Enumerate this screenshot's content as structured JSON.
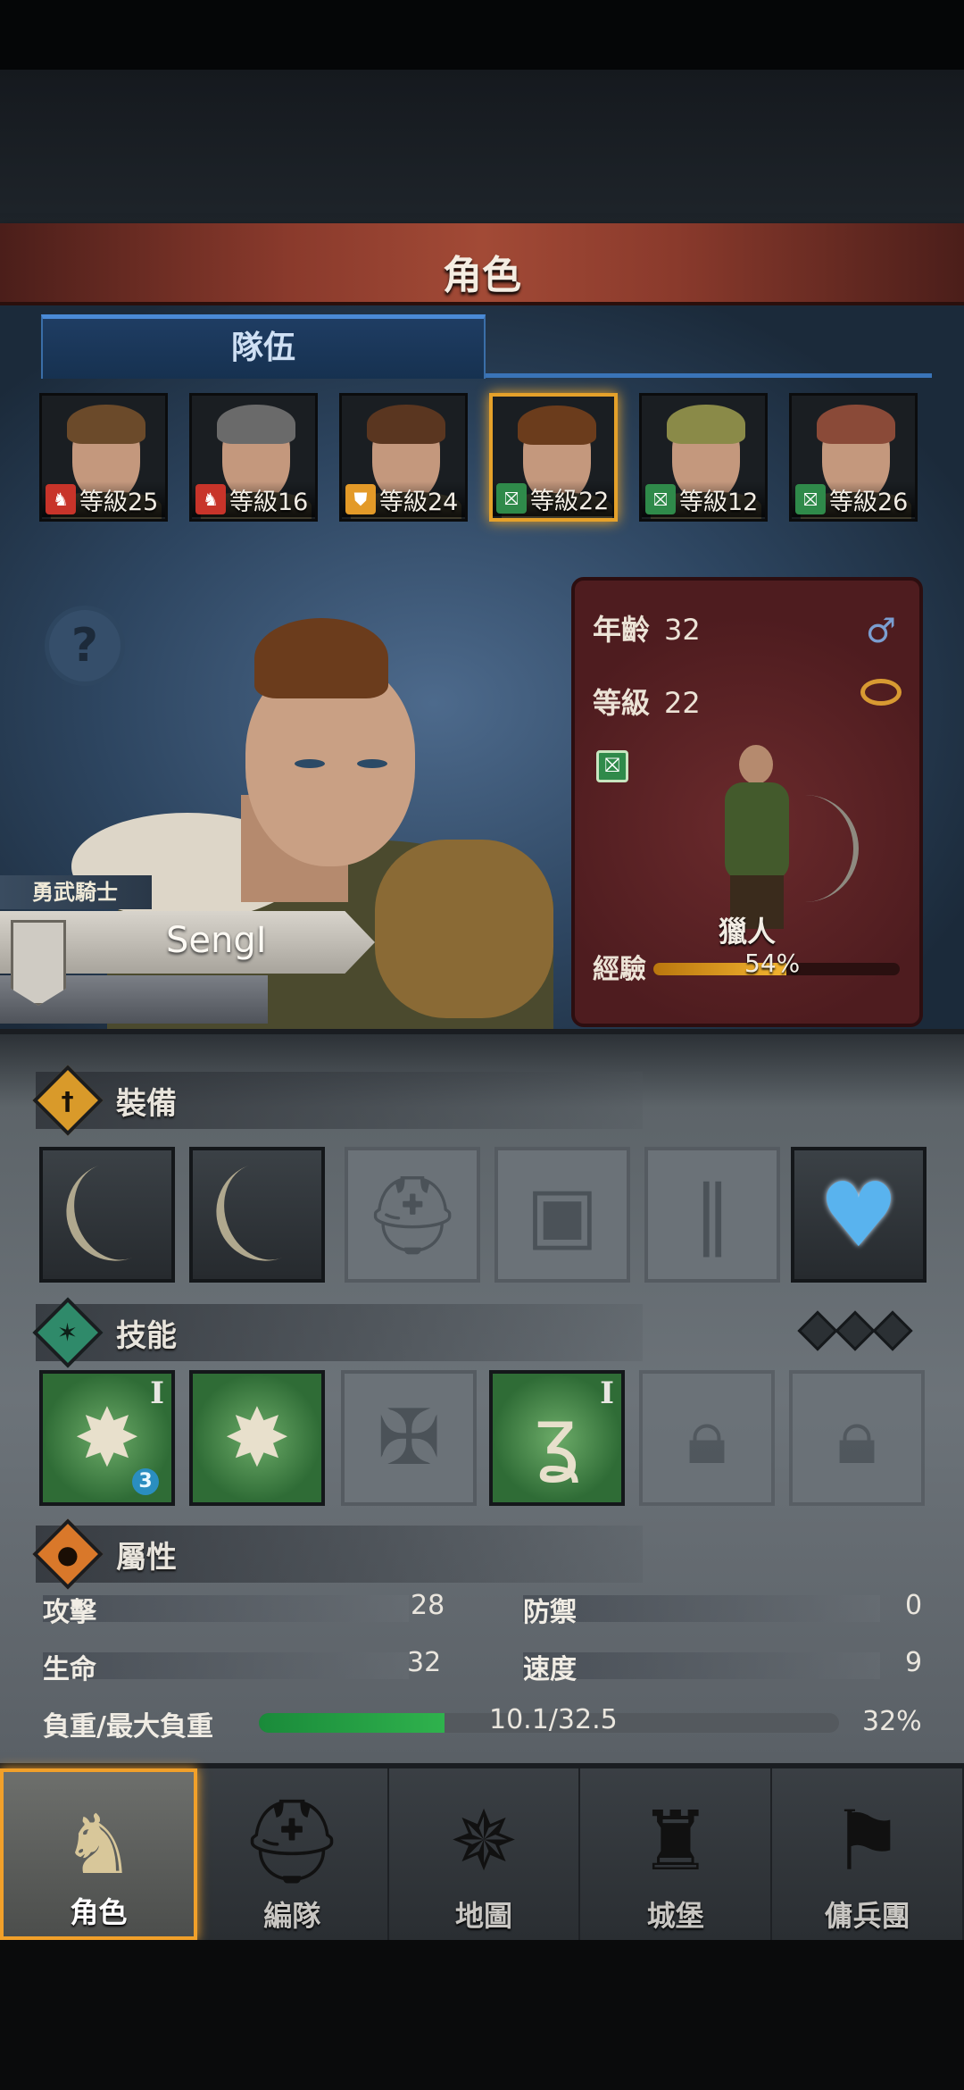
{
  "header": {
    "title": "角色"
  },
  "tabs": [
    {
      "label": "隊伍"
    }
  ],
  "party": [
    {
      "level_text": "等級25",
      "badge_icon": "horse-head-icon",
      "badge_color": "#c8342a",
      "hair_color": "#6b4a2a"
    },
    {
      "level_text": "等級16",
      "badge_icon": "horse-head-icon",
      "badge_color": "#c8342a",
      "hair_color": "#6a6a6a"
    },
    {
      "level_text": "等級24",
      "badge_icon": "shield-icon",
      "badge_color": "#e39a28",
      "hair_color": "#5a3620"
    },
    {
      "level_text": "等級22",
      "badge_icon": "crossed-bow-icon",
      "badge_color": "#2f8a4a",
      "hair_color": "#6b3c1c",
      "selected": true
    },
    {
      "level_text": "等級12",
      "badge_icon": "crossed-bow-icon",
      "badge_color": "#2f8a4a",
      "hair_color": "#8a8a48"
    },
    {
      "level_text": "等級26",
      "badge_icon": "crossed-bow-icon",
      "badge_color": "#2f8a4a",
      "hair_color": "#8a4a38"
    }
  ],
  "hero": {
    "title": "勇武騎士",
    "name": "SengI"
  },
  "info": {
    "age_label": "年齡",
    "age": "32",
    "level_label": "等級",
    "level": "22",
    "gender_symbol": "♂",
    "class_name": "獵人",
    "exp_label": "經驗",
    "exp_percent": 54,
    "exp_text": "54%"
  },
  "sections": {
    "equipment": "裝備",
    "skills": "技能",
    "attributes": "屬性"
  },
  "equipment": [
    {
      "icon": "bow-icon",
      "state": "filled"
    },
    {
      "icon": "bow-icon",
      "state": "filled"
    },
    {
      "icon": "helmet-icon",
      "state": "empty"
    },
    {
      "icon": "armor-icon",
      "state": "empty"
    },
    {
      "icon": "boots-icon",
      "state": "empty"
    },
    {
      "icon": "heart-amulet-icon",
      "state": "filled"
    }
  ],
  "skills": [
    {
      "icon": "sword-burst-icon",
      "state": "active",
      "rank": "I",
      "level": "3"
    },
    {
      "icon": "bow-burst-icon",
      "state": "active",
      "rank": "",
      "level": ""
    },
    {
      "icon": "cross-icon",
      "state": "empty",
      "rank": "",
      "level": ""
    },
    {
      "icon": "swift-foot-icon",
      "state": "active",
      "rank": "I",
      "level": ""
    },
    {
      "icon": "lock-icon",
      "state": "locked",
      "rank": "",
      "level": ""
    },
    {
      "icon": "lock-icon",
      "state": "locked",
      "rank": "",
      "level": ""
    }
  ],
  "attributes": {
    "attack_label": "攻擊",
    "attack": "28",
    "defense_label": "防禦",
    "defense": "0",
    "hp_label": "生命",
    "hp": "32",
    "speed_label": "速度",
    "speed": "9",
    "load_label": "負重/最大負重",
    "load": "10.1/32.5",
    "load_percent": 32,
    "load_text": "32%"
  },
  "nav": [
    {
      "label": "角色",
      "icon": "knight-icon",
      "active": true
    },
    {
      "label": "編隊",
      "icon": "helmet-group-icon",
      "active": false
    },
    {
      "label": "地圖",
      "icon": "compass-icon",
      "active": false
    },
    {
      "label": "城堡",
      "icon": "castle-icon",
      "active": false
    },
    {
      "label": "傭兵團",
      "icon": "mercenary-banner-icon",
      "active": false
    }
  ]
}
